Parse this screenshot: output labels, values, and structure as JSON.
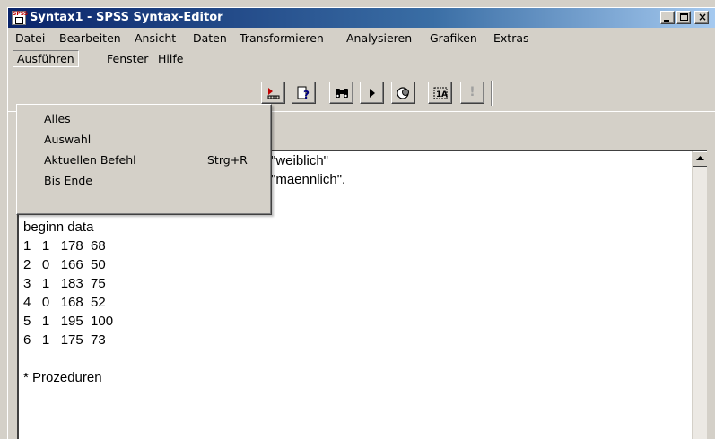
{
  "window": {
    "title": "Syntax1 - SPSS Syntax-Editor",
    "app_icon_label": "SPSS"
  },
  "menubar": {
    "items": [
      {
        "label": "Datei"
      },
      {
        "label": "Bearbeiten"
      },
      {
        "label": "Ansicht"
      },
      {
        "label": "Daten"
      },
      {
        "label": "Transformieren"
      },
      {
        "label": "Analysieren"
      },
      {
        "label": "Grafiken"
      },
      {
        "label": "Extras"
      },
      {
        "label": "Ausführen"
      },
      {
        "label": "Fenster"
      },
      {
        "label": "Hilfe"
      }
    ],
    "active_item": "Ausführen"
  },
  "dropdown": {
    "items": [
      {
        "label": "Alles",
        "shortcut": ""
      },
      {
        "label": "Auswahl",
        "shortcut": ""
      },
      {
        "label": "Aktuellen Befehl",
        "shortcut": "Strg+R"
      },
      {
        "label": "Bis Ende",
        "shortcut": ""
      }
    ]
  },
  "toolbar": {
    "buttons": [
      {
        "icon": "goto-case-icon"
      },
      {
        "icon": "syntax-help-icon"
      },
      {
        "icon": "find-binoculars-icon"
      },
      {
        "icon": "run-triangle-icon"
      },
      {
        "icon": "select-cases-icon"
      },
      {
        "icon": "value-labels-icon"
      },
      {
        "icon": "alert-exclamation-icon"
      }
    ]
  },
  "editor": {
    "visible_partial_lines": [
      "\"weiblich\"",
      "\"maennlich\"."
    ],
    "lines": [
      "",
      "beginn data",
      "1   1   178  68",
      "2   0   166  50",
      "3   1   183  75",
      "4   0   168  52",
      "5   1   195  100",
      "6   1   175  73",
      "",
      "* Prozeduren"
    ]
  },
  "colors": {
    "titlebar_start": "#0a246a",
    "titlebar_end": "#a6caf0",
    "face": "#d4d0c8"
  }
}
